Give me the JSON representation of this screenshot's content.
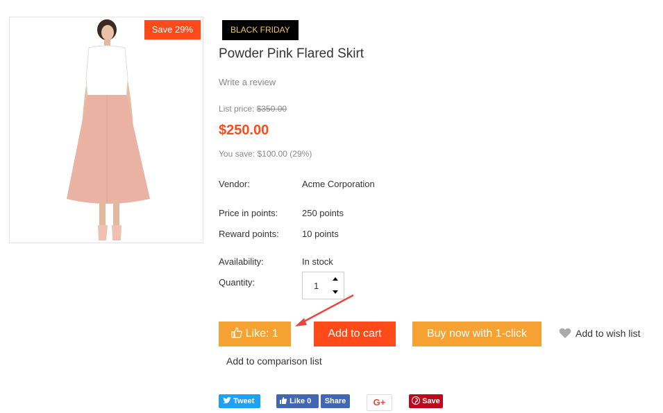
{
  "product": {
    "image_alt": "Powder Pink Flared Skirt",
    "save_badge": "Save 29%",
    "promo_badge": "BLACK FRIDAY",
    "title": "Powder Pink Flared Skirt",
    "review_link": "Write a review",
    "list_price_label": "List price:",
    "list_price": "$350.00",
    "price": "$250.00",
    "you_save": "You save: $100.00 (29%)"
  },
  "details": {
    "vendor_label": "Vendor:",
    "vendor": "Acme Corporation",
    "price_points_label": "Price in points:",
    "price_points": "250 points",
    "reward_points_label": "Reward points:",
    "reward_points": "10 points",
    "availability_label": "Availability:",
    "availability": "In stock",
    "quantity_label": "Quantity:",
    "quantity": "1"
  },
  "actions": {
    "like": "Like: 1",
    "add_to_cart": "Add to cart",
    "buy_now": "Buy now with 1-click",
    "wish_list": "Add to wish list",
    "comparison": "Add to comparison list"
  },
  "social": {
    "tweet": "Tweet",
    "fb_like": "Like 0",
    "fb_share": "Share",
    "gplus": "G+",
    "pin_save": "Save"
  },
  "colors": {
    "accent_orange": "#f6a233",
    "accent_red": "#ff4a1a",
    "promo_bg": "#000000",
    "promo_text": "#f7c74b"
  },
  "icons": [
    "thumbs-up-icon",
    "heart-icon",
    "twitter-icon",
    "facebook-icon",
    "pinterest-icon",
    "spin-up-icon",
    "spin-down-icon",
    "annotation-arrow"
  ]
}
